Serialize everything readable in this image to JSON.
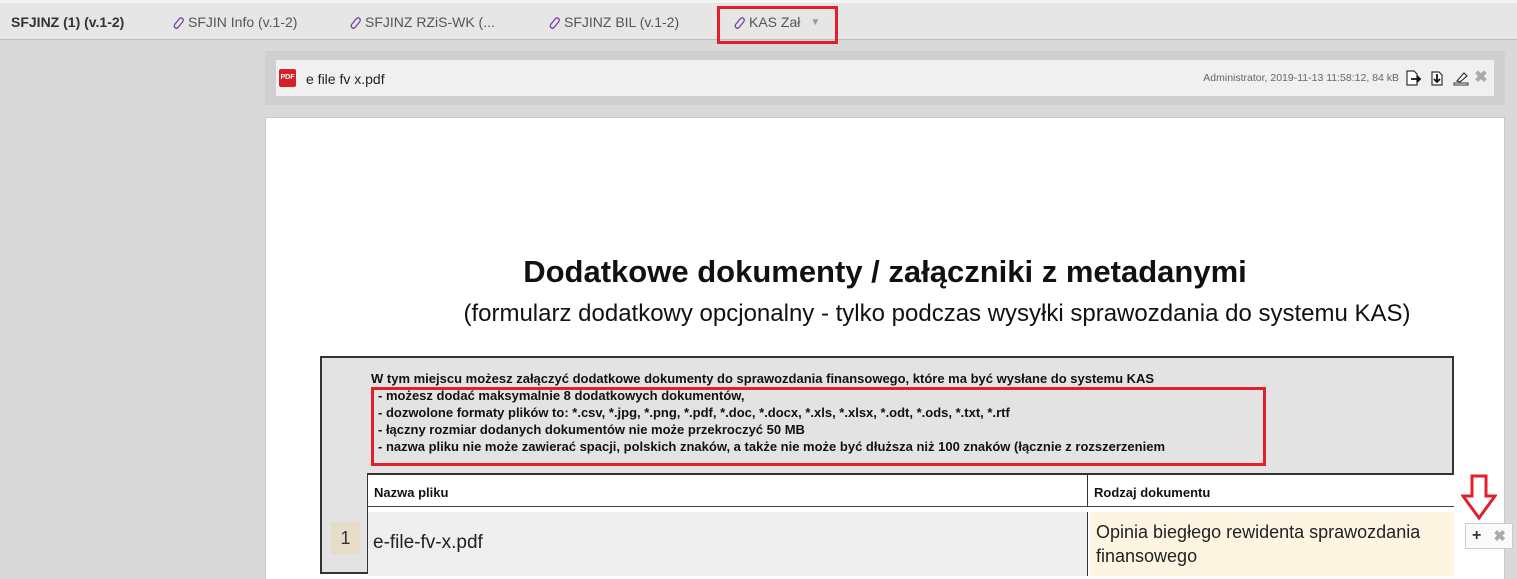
{
  "tabs": [
    {
      "label": "SFJINZ (1) (v.1-2)",
      "active": true,
      "icon": null
    },
    {
      "label": "SFJIN Info (v.1-2)",
      "active": false,
      "icon": "paperclip-icon"
    },
    {
      "label": "SFJINZ RZiS-WK (...",
      "active": false,
      "icon": "paperclip-icon"
    },
    {
      "label": "SFJINZ BIL (v.1-2)",
      "active": false,
      "icon": "paperclip-icon"
    },
    {
      "label": "KAS Zał",
      "active": false,
      "icon": "paperclip-icon",
      "dropdown": "▼"
    }
  ],
  "attachment": {
    "icon_text": "PDF",
    "file_name": "e file fv x.pdf",
    "meta": "Administrator, 2019-11-13 11:58:12, 84 kB",
    "actions": [
      "export-icon",
      "download-icon",
      "sign-icon",
      "close-icon"
    ],
    "close_glyph": "✖"
  },
  "document": {
    "title": "Dodatkowe dokumenty / załączniki z metadanymi",
    "subtitle": "(formularz dodatkowy opcjonalny - tylko podczas wysyłki sprawozdania do systemu KAS)",
    "info_lines": [
      "W tym miejscu możesz załączyć dodatkowe dokumenty do sprawozdania finansowego, które ma być wysłane do systemu KAS",
      "- możesz dodać maksymalnie 8 dodatkowych dokumentów,",
      "- dozwolone formaty plików to: *.csv, *.jpg, *.png, *.pdf, *.doc, *.docx, *.xls, *.xlsx, *.odt, *.ods, *.txt, *.rtf",
      "- łączny rozmiar dodanych dokumentów nie może przekroczyć 50 MB",
      "- nazwa pliku nie może zawierać spacji, polskich znaków, a także nie może być dłuższa niż 100 znaków (łącznie z rozszerzeniem"
    ],
    "table": {
      "headers": [
        "Nazwa pliku",
        "Rodzaj dokumentu"
      ],
      "rows": [
        {
          "num": "1",
          "file": "e-file-fv-x.pdf",
          "type": "Opinia biegłego rewidenta sprawozdania finansowego"
        }
      ]
    }
  },
  "row_controls": {
    "add": "+",
    "remove": "✖"
  },
  "colors": {
    "highlight": "#e0202a",
    "pdf": "#d71f26",
    "clip": "#7b3fa0"
  }
}
